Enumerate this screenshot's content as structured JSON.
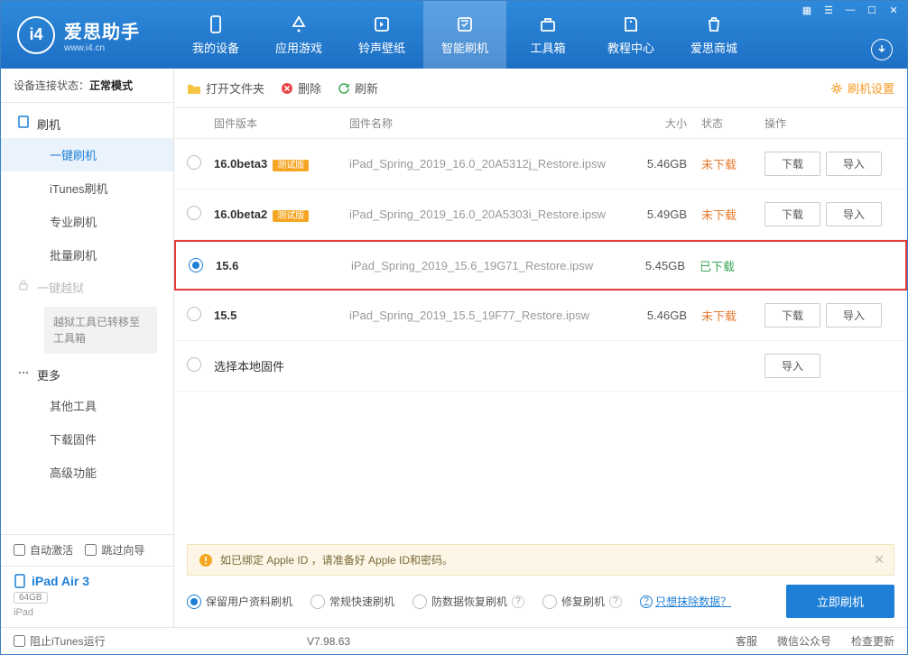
{
  "app": {
    "name": "爱思助手",
    "site": "www.i4.cn"
  },
  "header_tabs": [
    {
      "label": "我的设备"
    },
    {
      "label": "应用游戏"
    },
    {
      "label": "铃声壁纸"
    },
    {
      "label": "智能刷机",
      "active": true
    },
    {
      "label": "工具箱"
    },
    {
      "label": "教程中心"
    },
    {
      "label": "爱思商城"
    }
  ],
  "sidebar": {
    "status_label": "设备连接状态：",
    "status_value": "正常模式",
    "sections": {
      "flash": {
        "title": "刷机",
        "items": [
          "一键刷机",
          "iTunes刷机",
          "专业刷机",
          "批量刷机"
        ]
      },
      "jailbreak": {
        "title": "一键越狱",
        "note": "越狱工具已转移至工具箱"
      },
      "more": {
        "title": "更多",
        "items": [
          "其他工具",
          "下载固件",
          "高级功能"
        ]
      }
    },
    "auto_activate": "自动激活",
    "skip_guide": "跳过向导",
    "device": {
      "name": "iPad Air 3",
      "capacity": "64GB",
      "type": "iPad"
    }
  },
  "toolbar": {
    "open_folder": "打开文件夹",
    "delete": "删除",
    "refresh": "刷新",
    "settings": "刷机设置"
  },
  "table": {
    "headers": {
      "version": "固件版本",
      "name": "固件名称",
      "size": "大小",
      "status": "状态",
      "ops": "操作"
    },
    "btn_download": "下载",
    "btn_import": "导入",
    "local_firmware": "选择本地固件",
    "beta_badge": "测试版",
    "rows": [
      {
        "version": "16.0beta3",
        "beta": true,
        "name": "iPad_Spring_2019_16.0_20A5312j_Restore.ipsw",
        "size": "5.46GB",
        "status": "未下载",
        "downloaded": false,
        "selected": false
      },
      {
        "version": "16.0beta2",
        "beta": true,
        "name": "iPad_Spring_2019_16.0_20A5303i_Restore.ipsw",
        "size": "5.49GB",
        "status": "未下载",
        "downloaded": false,
        "selected": false
      },
      {
        "version": "15.6",
        "beta": false,
        "name": "iPad_Spring_2019_15.6_19G71_Restore.ipsw",
        "size": "5.45GB",
        "status": "已下载",
        "downloaded": true,
        "selected": true,
        "highlight": true
      },
      {
        "version": "15.5",
        "beta": false,
        "name": "iPad_Spring_2019_15.5_19F77_Restore.ipsw",
        "size": "5.46GB",
        "status": "未下载",
        "downloaded": false,
        "selected": false
      }
    ]
  },
  "notice": "如已绑定 Apple ID ，请准备好 Apple ID和密码。",
  "flash_options": {
    "keep_data": "保留用户资料刷机",
    "normal": "常规快速刷机",
    "anti_recovery": "防数据恢复刷机",
    "repair": "修复刷机",
    "erase_link": "只想抹除数据？",
    "flash_now": "立即刷机"
  },
  "footer": {
    "block_itunes": "阻止iTunes运行",
    "version": "V7.98.63",
    "service": "客服",
    "wechat": "微信公众号",
    "update": "检查更新"
  }
}
